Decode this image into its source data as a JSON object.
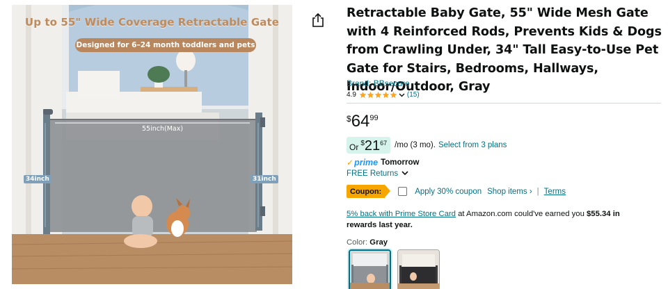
{
  "image": {
    "headline": "Up to 55\" Wide Coverage Retractable Gate",
    "subheadline": "Designed for 6–24 month toddlers and pets",
    "width_label": "55inch(Max)",
    "left_height_label": "34inch",
    "right_height_label": "31inch"
  },
  "share": {
    "icon": "share-icon"
  },
  "product": {
    "title": "Retractable Baby Gate, 55\" Wide Mesh Gate with 4 Reinforced Rods, Prevents Kids & Dogs from Crawling Under, 34\" Tall Easy-to-Use Pet Gate for Stairs, Bedrooms, Hallways, Indoor/Outdoor, Gray",
    "brand": "Brand: BBsecure",
    "rating_value": "4.9",
    "rating_stars": 4.9,
    "rating_count": "(15)"
  },
  "price": {
    "symbol": "$",
    "whole": "64",
    "fraction": "99"
  },
  "monthly": {
    "prefix": "Or",
    "symbol": "$",
    "whole": "21",
    "fraction": "67",
    "term": "/mo (3 mo).",
    "plans_link": "Select from 3 plans"
  },
  "delivery": {
    "prime_label": "prime",
    "day": "Tomorrow",
    "returns": "FREE Returns"
  },
  "coupon": {
    "badge": "Coupon:",
    "apply": "Apply 30% coupon",
    "shop_items": "Shop items ›",
    "separator": "|",
    "terms": "Terms"
  },
  "promo": {
    "link": "5% back with Prime Store Card",
    "text": " at Amazon.com could've earned you ",
    "amount": "$55.34 in rewards last year."
  },
  "color": {
    "label": "Color:",
    "value": "Gray"
  },
  "colors": {
    "accent": "#007185",
    "prime_blue": "#1a98ff",
    "coupon_orange": "#f7a600",
    "star": "#ffa41c"
  }
}
